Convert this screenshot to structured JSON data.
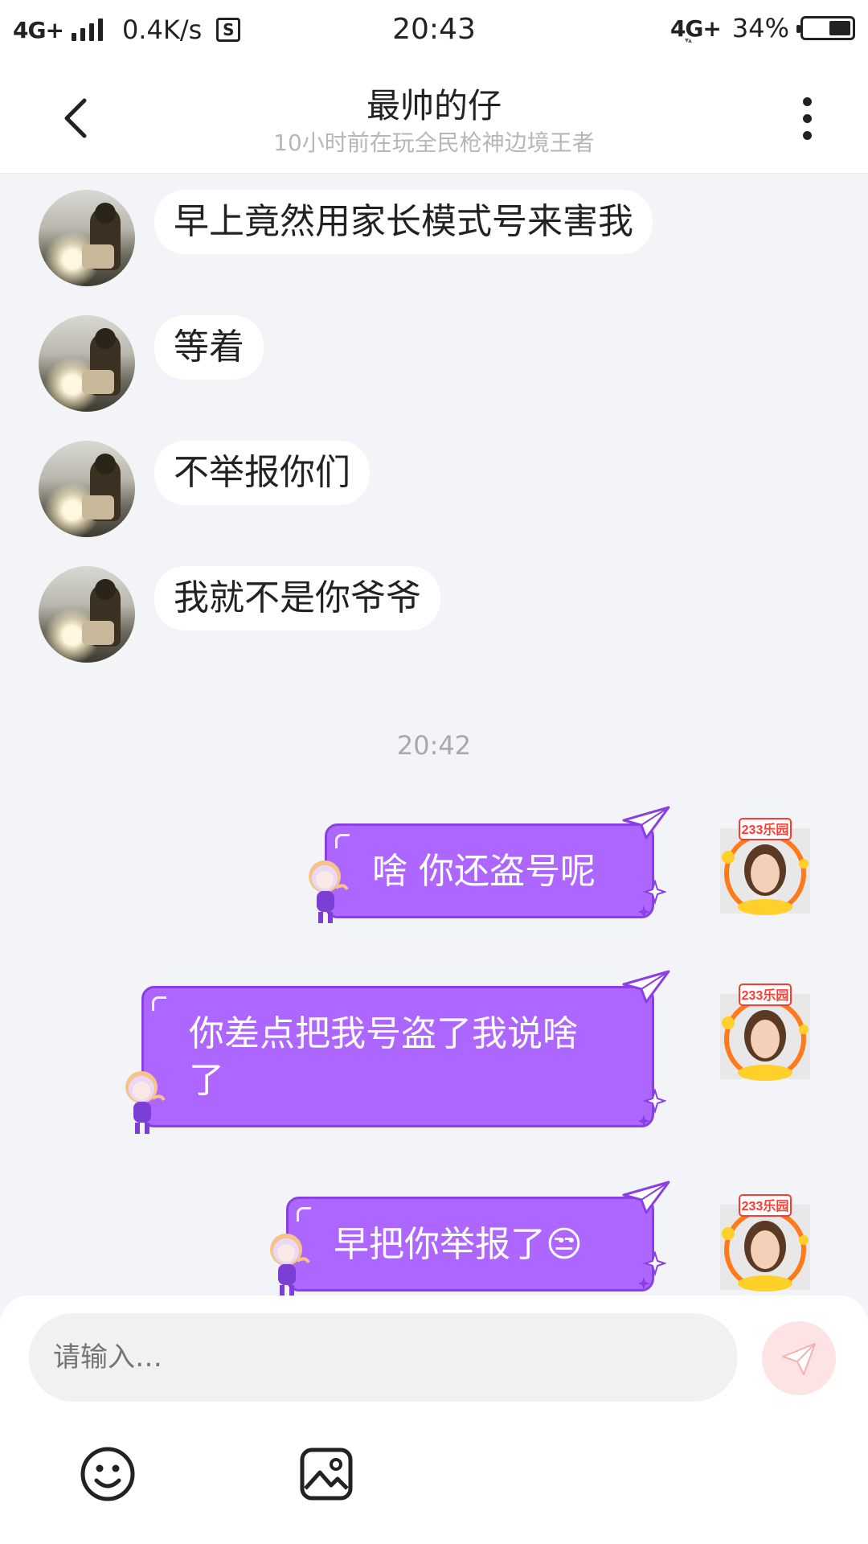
{
  "status_bar": {
    "network": "4G+",
    "speed": "0.4K/s",
    "s_icon": "S",
    "time": "20:43",
    "network_right": "4G+",
    "battery": "34%",
    "battery_level": 0.34
  },
  "header": {
    "title": "最帅的仔",
    "subtitle": "10小时前在玩全民枪神边境王者"
  },
  "messages": {
    "incoming": [
      {
        "text": "早上竟然用家长模式号来害我"
      },
      {
        "text": "等着"
      },
      {
        "text": "不举报你们"
      },
      {
        "text": "我就不是你爷爷"
      }
    ],
    "timestamp": "20:42",
    "outgoing": [
      {
        "text": "啥 你还盗号呢"
      },
      {
        "line1": "你差点把我号盗了我说啥",
        "line2": "了"
      },
      {
        "text": "早把你举报了😒"
      }
    ],
    "avatar_badge": "233乐园"
  },
  "input": {
    "placeholder": "请输入…"
  },
  "icons": {
    "back": "back-arrow-icon",
    "more": "more-vertical-icon",
    "send": "send-plane-icon",
    "emoji": "emoji-face-icon",
    "image": "image-picture-icon"
  },
  "colors": {
    "bubble_out": "#ad66ff",
    "bubble_in": "#ffffff",
    "background": "#f3f4f7",
    "send_bg": "#fde3e3"
  }
}
